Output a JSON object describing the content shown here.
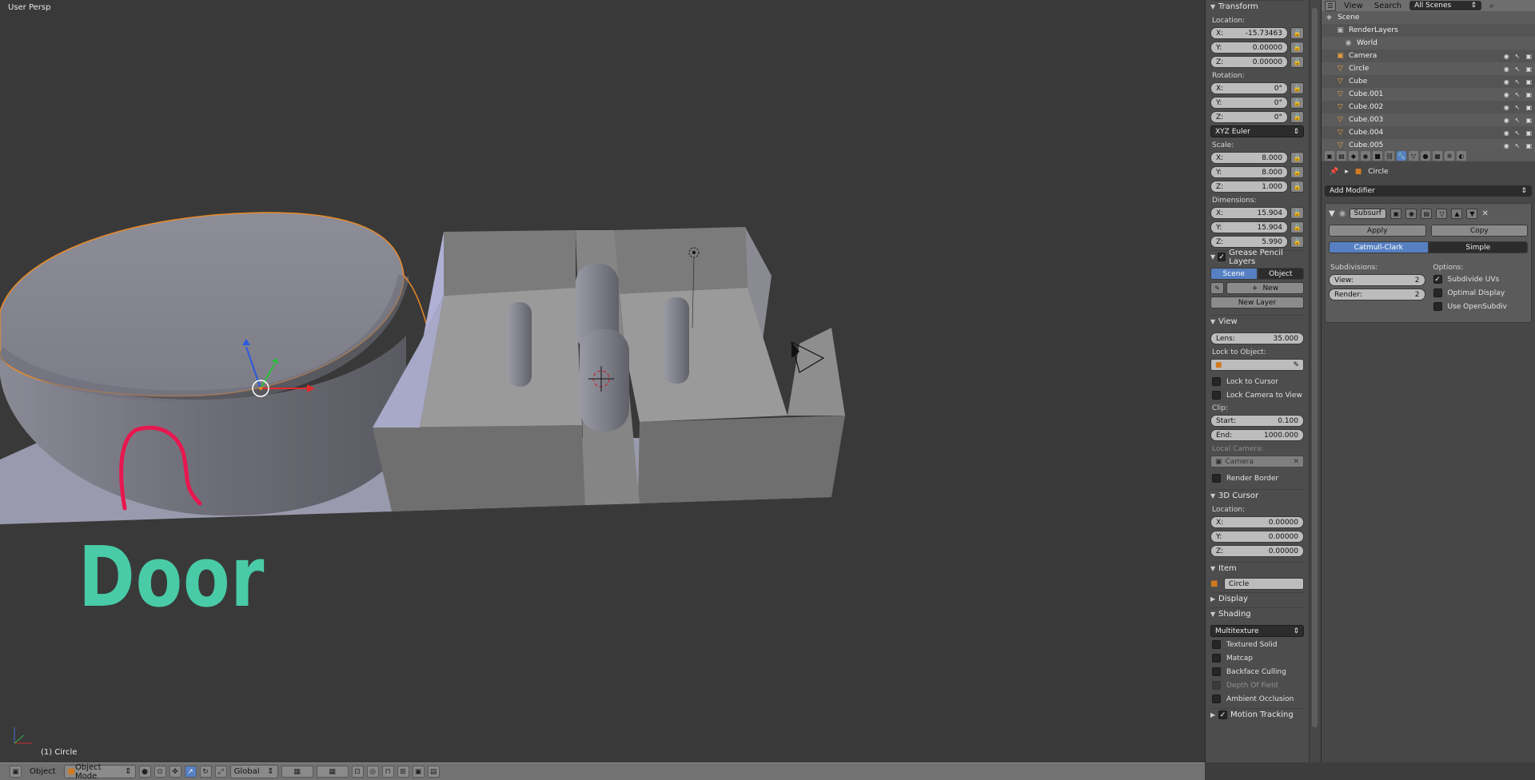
{
  "viewport": {
    "view_label": "User Persp",
    "object_label": "(1) Circle",
    "annotation": "Door"
  },
  "bottombar": {
    "object_menu": "Object",
    "mode": "Object Mode",
    "orientation": "Global"
  },
  "npanel": {
    "transform": {
      "title": "Transform",
      "location_label": "Location:",
      "location": [
        {
          "axis": "X:",
          "value": "-15.73463"
        },
        {
          "axis": "Y:",
          "value": "0.00000"
        },
        {
          "axis": "Z:",
          "value": "0.00000"
        }
      ],
      "rotation_label": "Rotation:",
      "rotation": [
        {
          "axis": "X:",
          "value": "0°"
        },
        {
          "axis": "Y:",
          "value": "0°"
        },
        {
          "axis": "Z:",
          "value": "0°"
        }
      ],
      "rotation_mode": "XYZ Euler",
      "scale_label": "Scale:",
      "scale": [
        {
          "axis": "X:",
          "value": "8.000"
        },
        {
          "axis": "Y:",
          "value": "8.000"
        },
        {
          "axis": "Z:",
          "value": "1.000"
        }
      ],
      "dimensions_label": "Dimensions:",
      "dimensions": [
        {
          "axis": "X:",
          "value": "15.904"
        },
        {
          "axis": "Y:",
          "value": "15.904"
        },
        {
          "axis": "Z:",
          "value": "5.990"
        }
      ]
    },
    "grease": {
      "title": "Grease Pencil Layers",
      "scene_tab": "Scene",
      "object_tab": "Object",
      "new_label": "New",
      "new_layer_label": "New Layer"
    },
    "view": {
      "title": "View",
      "lens_label": "Lens:",
      "lens_value": "35.000",
      "lock_to_object": "Lock to Object:",
      "lock_to_cursor": "Lock to Cursor",
      "lock_camera": "Lock Camera to View",
      "clip_label": "Clip:",
      "clip_start_label": "Start:",
      "clip_start": "0.100",
      "clip_end_label": "End:",
      "clip_end": "1000.000",
      "local_camera": "Local Camera:",
      "camera": "Camera",
      "render_border": "Render Border"
    },
    "cursor": {
      "title": "3D Cursor",
      "location_label": "Location:",
      "location": [
        {
          "axis": "X:",
          "value": "0.00000"
        },
        {
          "axis": "Y:",
          "value": "0.00000"
        },
        {
          "axis": "Z:",
          "value": "0.00000"
        }
      ]
    },
    "item": {
      "title": "Item",
      "name": "Circle"
    },
    "display": {
      "title": "Display"
    },
    "shading": {
      "title": "Shading",
      "mode": "Multitexture",
      "options": [
        "Textured Solid",
        "Matcap",
        "Backface Culling",
        "Depth Of Field",
        "Ambient Occlusion"
      ]
    },
    "motion": {
      "title": "Motion Tracking"
    }
  },
  "outliner": {
    "menu_view": "View",
    "menu_search": "Search",
    "scenes": "All Scenes",
    "rows": [
      "Scene",
      "RenderLayers",
      "World",
      "Camera",
      "Circle",
      "Cube",
      "Cube.001",
      "Cube.002",
      "Cube.003",
      "Cube.004",
      "Cube.005"
    ]
  },
  "properties": {
    "context": "Circle",
    "add_modifier": "Add Modifier",
    "modifier_name": "Subsurf",
    "apply": "Apply",
    "copy": "Copy",
    "catmull": "Catmull-Clark",
    "simple": "Simple",
    "subdivisions": "Subdivisions:",
    "view_label": "View:",
    "view_value": "2",
    "render_label": "Render:",
    "render_value": "2",
    "options": "Options:",
    "subdivide_uvs": "Subdivide UVs",
    "optimal_display": "Optimal Display",
    "use_opensubdiv": "Use OpenSubdiv"
  },
  "colors": {
    "accent": "#5680c2",
    "door_text": "#48cba6",
    "door_stroke": "#e8174f",
    "selection": "#e88a28"
  }
}
